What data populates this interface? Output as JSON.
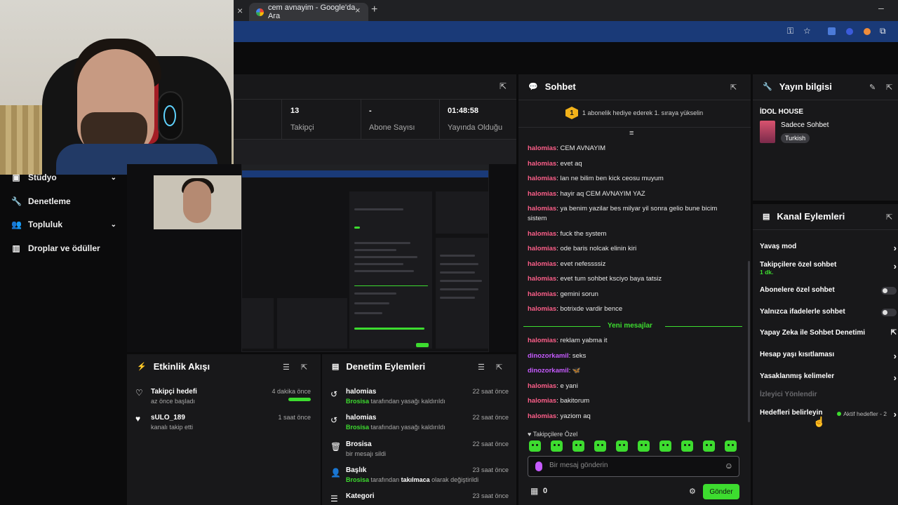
{
  "browser": {
    "tab_title": "cem avnayim - Google'da Ara"
  },
  "nav": {
    "items": [
      {
        "label": "Stüdyo",
        "icon": "video-icon",
        "expandable": true
      },
      {
        "label": "Denetleme",
        "icon": "wrench-icon",
        "expandable": false
      },
      {
        "label": "Topluluk",
        "icon": "users-icon",
        "expandable": true
      },
      {
        "label": "Droplar ve ödüller",
        "icon": "gift-icon",
        "expandable": false
      }
    ]
  },
  "stats": {
    "followers_value": "13",
    "followers_label": "Takipçi",
    "subs_value": "-",
    "subs_label": "Abone Sayısı",
    "uptime_value": "01:48:58",
    "uptime_label": "Yayında Olduğu"
  },
  "activity": {
    "title": "Etkinlik Akışı",
    "items": [
      {
        "icon": "heart-outline-icon",
        "title": "Takipçi hedefi",
        "sub": "az önce başladı",
        "ago": "4 dakika önce",
        "progress": 1.0
      },
      {
        "icon": "heart-icon",
        "title": "sULO_189",
        "sub": "kanalı takip etti",
        "ago": "1 saat önce"
      }
    ]
  },
  "moderation": {
    "title": "Denetim Eylemleri",
    "items": [
      {
        "icon": "undo-icon",
        "title": "halomias",
        "actor": "Brosisa",
        "sub": "tarafından yasağı kaldırıldı",
        "ago": "22 saat önce"
      },
      {
        "icon": "undo-icon",
        "title": "halomias",
        "actor": "Brosisa",
        "sub": "tarafından yasağı kaldırıldı",
        "ago": "22 saat önce"
      },
      {
        "icon": "trash-icon",
        "title": "Brosisa",
        "actor": "",
        "sub": "bir mesajı sildi",
        "ago": "22 saat önce"
      },
      {
        "icon": "user-edit-icon",
        "title": "Başlık",
        "actor": "Brosisa",
        "sub_pre": "tarafından",
        "sub_bold": "takılmaca",
        "sub": "olarak değiştirildi",
        "ago": "23 saat önce"
      },
      {
        "icon": "list-icon",
        "title": "Kategori",
        "actor": "",
        "sub": "",
        "ago": "23 saat önce"
      }
    ]
  },
  "chat": {
    "title": "Sohbet",
    "gift_rank": "1",
    "gift_text": "1 abonelik hediye ederek 1. sıraya yükselin",
    "messages_before": [
      {
        "user": "halomias",
        "color": "pink",
        "text": "CEM AVNAYIM"
      },
      {
        "user": "halomias",
        "color": "pink",
        "text": "evet aq"
      },
      {
        "user": "halomias",
        "color": "pink",
        "text": "lan ne bilim ben kick ceosu muyum"
      },
      {
        "user": "halomias",
        "color": "pink",
        "text": "hayir aq CEM AVNAYIM YAZ"
      },
      {
        "user": "halomias",
        "color": "pink",
        "text": "ya benim yazilar bes milyar yil sonra gelio bune bicim sistem"
      },
      {
        "user": "halomias",
        "color": "pink",
        "text": "fuck the system"
      },
      {
        "user": "halomias",
        "color": "pink",
        "text": "ode baris nolcak elinin kiri"
      },
      {
        "user": "halomias",
        "color": "pink",
        "text": "evet nefessssiz"
      },
      {
        "user": "halomias",
        "color": "pink",
        "text": "evet tum sohbet ksciyo baya tatsiz"
      },
      {
        "user": "halomias",
        "color": "pink",
        "text": "gemini sorun"
      },
      {
        "user": "halomias",
        "color": "pink",
        "text": "botrixde vardir bence"
      }
    ],
    "new_messages_label": "Yeni mesajlar",
    "messages_after": [
      {
        "user": "halomias",
        "color": "pink",
        "text": "reklam yabma it"
      },
      {
        "user": "dinozorkamil",
        "color": "purple",
        "text": "seks"
      },
      {
        "user": "dinozorkamil",
        "color": "purple",
        "text": "🦋"
      },
      {
        "user": "halomias",
        "color": "pink",
        "text": "e yani"
      },
      {
        "user": "halomias",
        "color": "pink",
        "text": "bakitorum"
      },
      {
        "user": "halomias",
        "color": "pink",
        "text": "yaziom aq"
      }
    ],
    "followers_only": "Takipçilere Özel",
    "input_placeholder": "Bir mesaj gönderin",
    "points": "0",
    "send_label": "Gönder"
  },
  "stream_info": {
    "title": "Yayın bilgisi",
    "stream_title": "İDOL HOUSE",
    "category": "Sadece Sohbet",
    "tag": "Turkish"
  },
  "channel_actions": {
    "title": "Kanal Eylemleri",
    "slow_mode": "Yavaş mod",
    "followers_only": "Takipçilere özel sohbet",
    "followers_only_sub": "1 dk.",
    "subs_only": "Abonelere özel sohbet",
    "emote_only": "Yalnızca ifadelerle sohbet",
    "ai_mod": "Yapay Zeka ile Sohbet Denetimi",
    "account_age": "Hesap yaşı kısıtlaması",
    "banned_words": "Yasaklanmış kelimeler",
    "viewer_redirect": "İzleyici Yönlendir",
    "set_goals": "Hedefleri belirleyin",
    "active_goals": "Aktif hedefler - 2"
  },
  "colors": {
    "accent": "#3ddc2f",
    "user_pink": "#ff5f8a",
    "user_purple": "#c65bff",
    "panel": "#18181a"
  }
}
